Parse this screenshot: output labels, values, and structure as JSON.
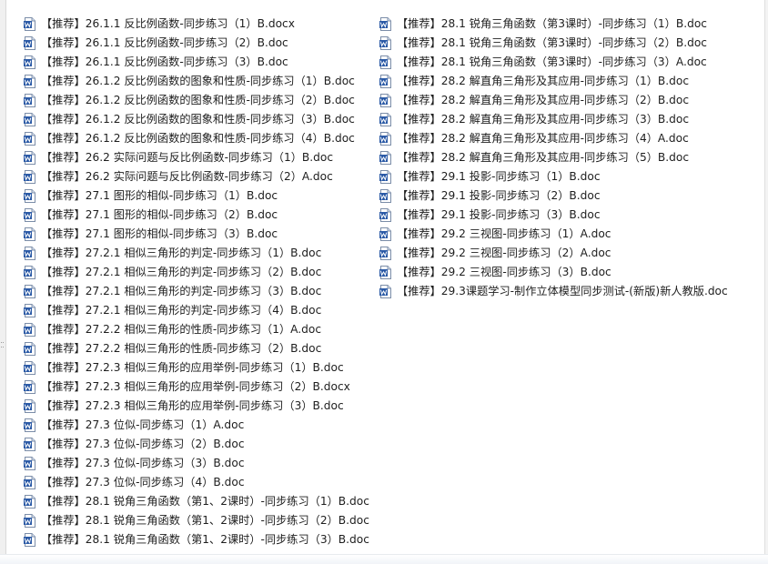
{
  "file_list": {
    "left_column": [
      {
        "name": "【推荐】26.1.1 反比例函数-同步练习（1）B.docx",
        "icon": "word-document-icon"
      },
      {
        "name": "【推荐】26.1.1 反比例函数-同步练习（2）B.doc",
        "icon": "word-document-icon"
      },
      {
        "name": "【推荐】26.1.1 反比例函数-同步练习（3）B.doc",
        "icon": "word-document-icon"
      },
      {
        "name": "【推荐】26.1.2 反比例函数的图象和性质-同步练习（1）B.doc",
        "icon": "word-document-icon"
      },
      {
        "name": "【推荐】26.1.2 反比例函数的图象和性质-同步练习（2）B.doc",
        "icon": "word-document-icon"
      },
      {
        "name": "【推荐】26.1.2 反比例函数的图象和性质-同步练习（3）B.doc",
        "icon": "word-document-icon"
      },
      {
        "name": "【推荐】26.1.2 反比例函数的图象和性质-同步练习（4）B.doc",
        "icon": "word-document-icon"
      },
      {
        "name": "【推荐】26.2 实际问题与反比例函数-同步练习（1）B.doc",
        "icon": "word-document-icon"
      },
      {
        "name": "【推荐】26.2 实际问题与反比例函数-同步练习（2）A.doc",
        "icon": "word-document-icon"
      },
      {
        "name": "【推荐】27.1 图形的相似-同步练习（1）B.doc",
        "icon": "word-document-icon"
      },
      {
        "name": "【推荐】27.1 图形的相似-同步练习（2）B.doc",
        "icon": "word-document-icon"
      },
      {
        "name": "【推荐】27.1 图形的相似-同步练习（3）B.doc",
        "icon": "word-document-icon"
      },
      {
        "name": "【推荐】27.2.1 相似三角形的判定-同步练习（1）B.doc",
        "icon": "word-document-icon"
      },
      {
        "name": "【推荐】27.2.1 相似三角形的判定-同步练习（2）B.doc",
        "icon": "word-document-icon"
      },
      {
        "name": "【推荐】27.2.1 相似三角形的判定-同步练习（3）B.doc",
        "icon": "word-document-icon"
      },
      {
        "name": "【推荐】27.2.1 相似三角形的判定-同步练习（4）B.doc",
        "icon": "word-document-icon"
      },
      {
        "name": "【推荐】27.2.2 相似三角形的性质-同步练习（1）A.doc",
        "icon": "word-document-icon"
      },
      {
        "name": "【推荐】27.2.2 相似三角形的性质-同步练习（2）B.doc",
        "icon": "word-document-icon"
      },
      {
        "name": "【推荐】27.2.3 相似三角形的应用举例-同步练习（1）B.doc",
        "icon": "word-document-icon"
      },
      {
        "name": "【推荐】27.2.3 相似三角形的应用举例-同步练习（2）B.docx",
        "icon": "word-document-icon"
      },
      {
        "name": "【推荐】27.2.3 相似三角形的应用举例-同步练习（3）B.doc",
        "icon": "word-document-icon"
      },
      {
        "name": "【推荐】27.3 位似-同步练习（1）A.doc",
        "icon": "word-document-icon"
      },
      {
        "name": "【推荐】27.3 位似-同步练习（2）B.doc",
        "icon": "word-document-icon"
      },
      {
        "name": "【推荐】27.3 位似-同步练习（3）B.doc",
        "icon": "word-document-icon"
      },
      {
        "name": "【推荐】27.3 位似-同步练习（4）B.doc",
        "icon": "word-document-icon"
      },
      {
        "name": "【推荐】28.1 锐角三角函数（第1、2课时）-同步练习（1）B.doc",
        "icon": "word-document-icon"
      },
      {
        "name": "【推荐】28.1 锐角三角函数（第1、2课时）-同步练习（2）B.doc",
        "icon": "word-document-icon"
      },
      {
        "name": "【推荐】28.1 锐角三角函数（第1、2课时）-同步练习（3）B.doc",
        "icon": "word-document-icon"
      }
    ],
    "right_column": [
      {
        "name": "【推荐】28.1 锐角三角函数（第3课时）-同步练习（1）B.doc",
        "icon": "word-document-icon"
      },
      {
        "name": "【推荐】28.1 锐角三角函数（第3课时）-同步练习（2）B.doc",
        "icon": "word-document-icon"
      },
      {
        "name": "【推荐】28.1 锐角三角函数（第3课时）-同步练习（3）A.doc",
        "icon": "word-document-icon"
      },
      {
        "name": "【推荐】28.2 解直角三角形及其应用-同步练习（1）B.doc",
        "icon": "word-document-icon"
      },
      {
        "name": "【推荐】28.2 解直角三角形及其应用-同步练习（2）B.doc",
        "icon": "word-document-icon"
      },
      {
        "name": "【推荐】28.2 解直角三角形及其应用-同步练习（3）B.doc",
        "icon": "word-document-icon"
      },
      {
        "name": "【推荐】28.2 解直角三角形及其应用-同步练习（4）A.doc",
        "icon": "word-document-icon"
      },
      {
        "name": "【推荐】28.2 解直角三角形及其应用-同步练习（5）B.doc",
        "icon": "word-document-icon"
      },
      {
        "name": "【推荐】29.1 投影-同步练习（1）B.doc",
        "icon": "word-document-icon"
      },
      {
        "name": "【推荐】29.1 投影-同步练习（2）B.doc",
        "icon": "word-document-icon"
      },
      {
        "name": "【推荐】29.1 投影-同步练习（3）B.doc",
        "icon": "word-document-icon"
      },
      {
        "name": "【推荐】29.2 三视图-同步练习（1）A.doc",
        "icon": "word-document-icon"
      },
      {
        "name": "【推荐】29.2 三视图-同步练习（2）A.doc",
        "icon": "word-document-icon"
      },
      {
        "name": "【推荐】29.2 三视图-同步练习（3）B.doc",
        "icon": "word-document-icon"
      },
      {
        "name": "【推荐】29.3课题学习-制作立体模型同步测试-(新版)新人教版.doc",
        "icon": "word-document-icon"
      }
    ]
  },
  "colors": {
    "icon_blue": "#2b5aa6",
    "icon_page": "#ffffff",
    "text": "#1e1e1e"
  }
}
